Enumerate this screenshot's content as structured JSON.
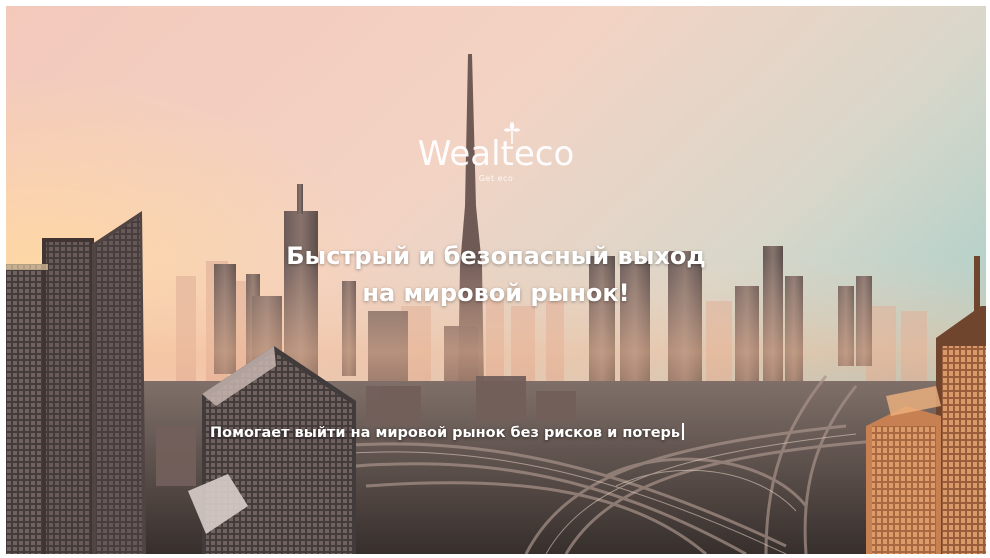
{
  "hero": {
    "logo": {
      "wordmark": "Wealteco",
      "tagline": "Get eco"
    },
    "headline": {
      "line1": "Быстрый и безопасный выход",
      "line2": "на мировой рынок!"
    },
    "subheadline": "Помогает выйти на мировой рынок без рисков и потерь",
    "background_image": "city-skyline-photo",
    "colors": {
      "sky_top": "#b9d4cf",
      "sky_warm": "#f6c8b0",
      "text": "#ffffff"
    }
  }
}
